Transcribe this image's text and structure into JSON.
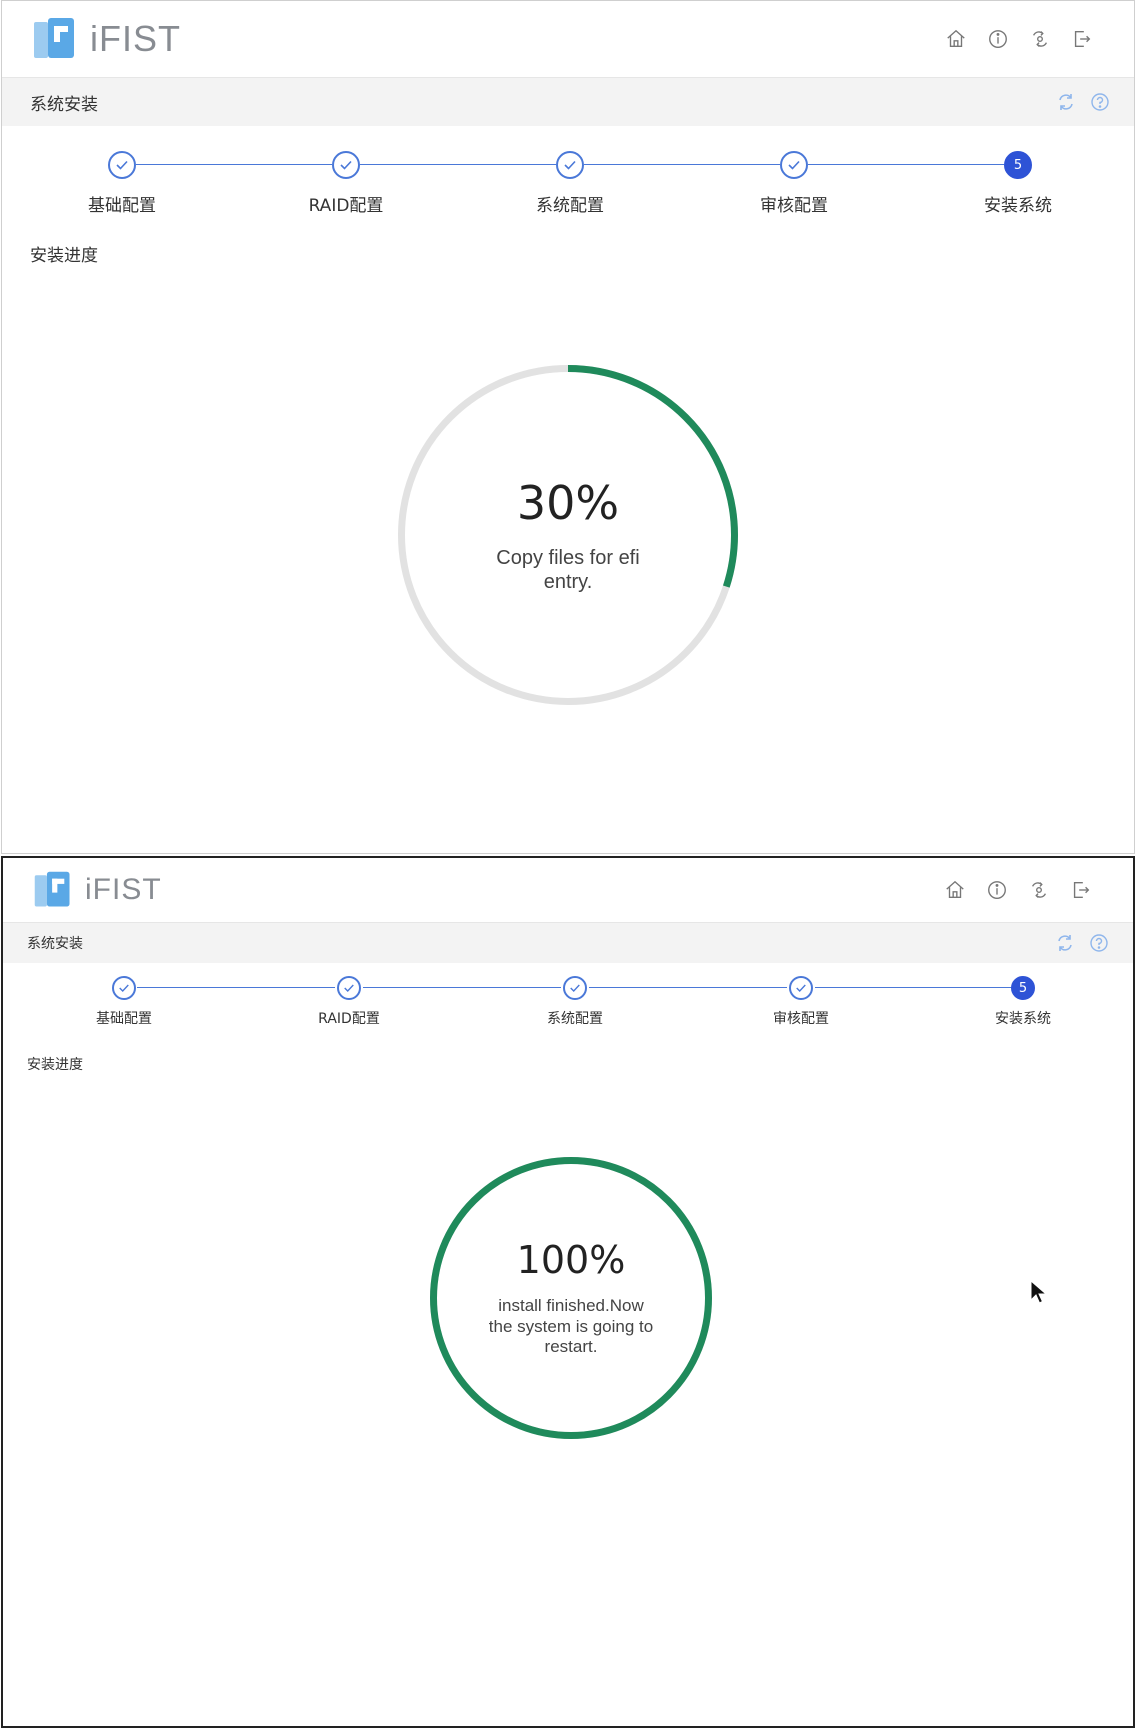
{
  "app": {
    "name": "iFIST",
    "brand_color": "#5aa8e6"
  },
  "header_icons": [
    "home-icon",
    "info-icon",
    "settings-icon",
    "logout-icon"
  ],
  "subbar": {
    "title": "系统安装",
    "icons": [
      "refresh-icon",
      "help-icon"
    ]
  },
  "steps": [
    {
      "label": "基础配置",
      "state": "done"
    },
    {
      "label": "RAID配置",
      "state": "done"
    },
    {
      "label": "系统配置",
      "state": "done"
    },
    {
      "label": "审核配置",
      "state": "done"
    },
    {
      "label": "安装系统",
      "state": "active",
      "number": "5"
    }
  ],
  "progress_heading": "安装进度",
  "colors": {
    "progress": "#1f8a5b",
    "track": "#e2e2e2",
    "step_accent": "#4a78d8",
    "active_step": "#2e53d6"
  },
  "screens": [
    {
      "percent_text": "30%",
      "progress": 0.3,
      "message": "Copy files for efi entry."
    },
    {
      "percent_text": "100%",
      "progress": 1.0,
      "message": "install finished.Now the system is going to restart."
    }
  ]
}
